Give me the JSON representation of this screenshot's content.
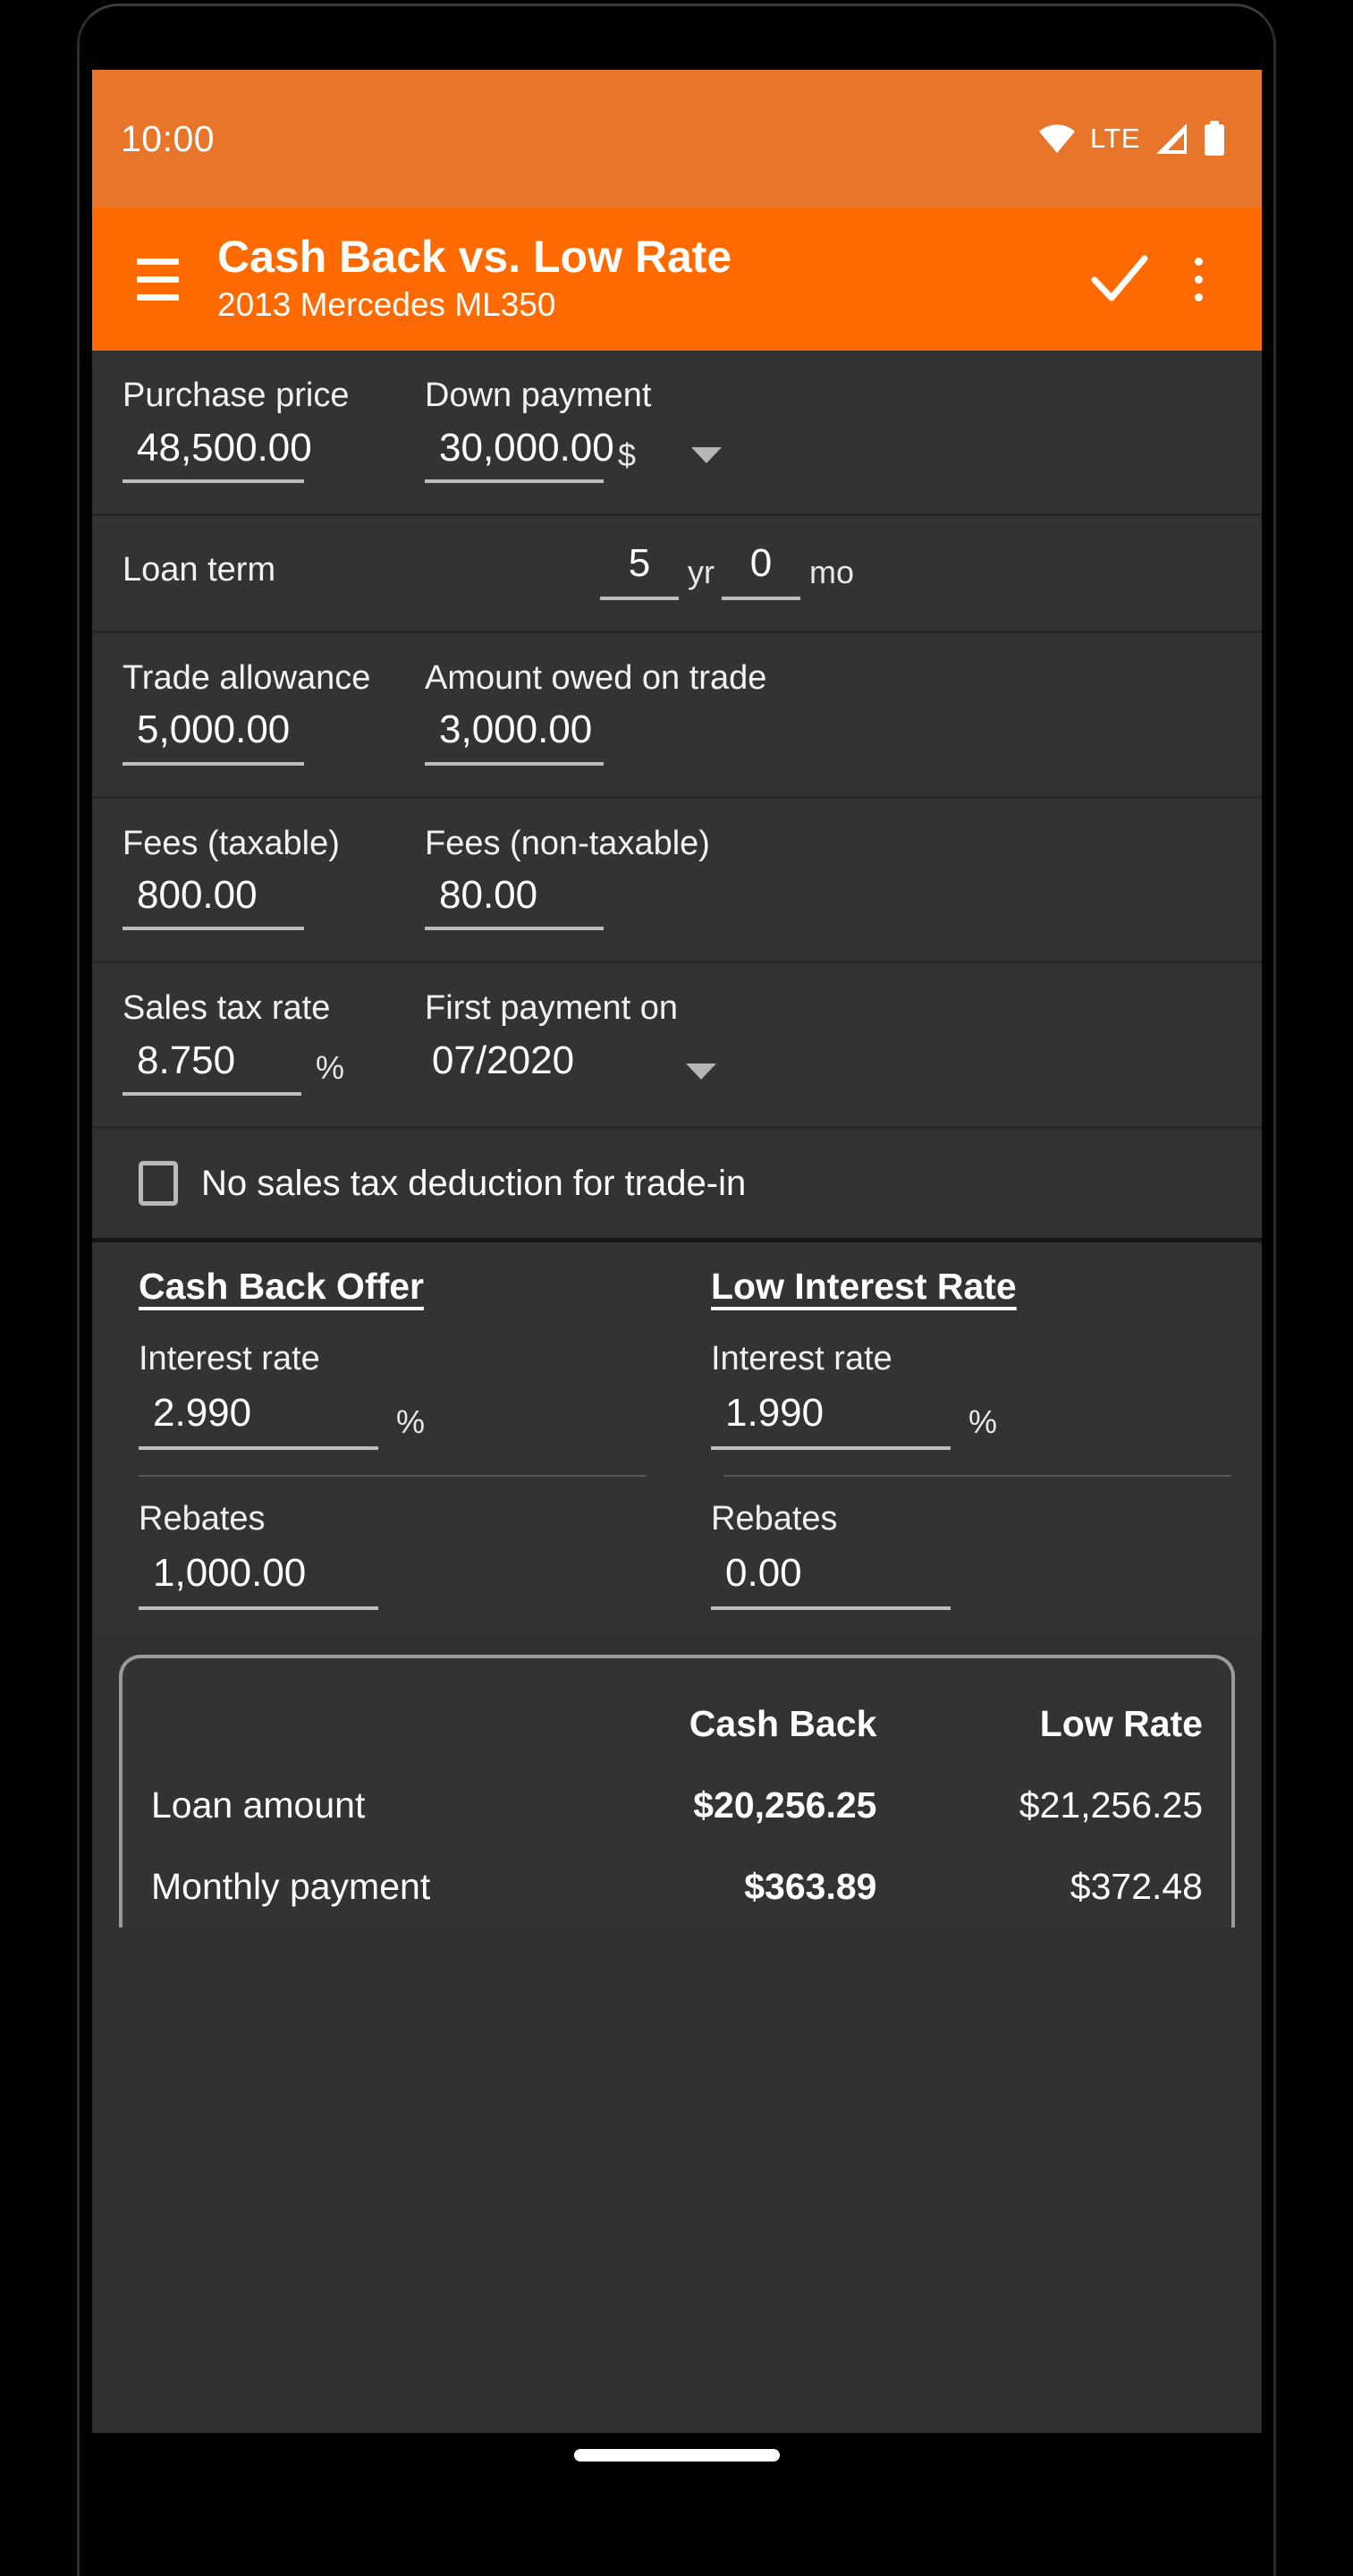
{
  "status_bar": {
    "clock": "10:00",
    "network_label": "LTE",
    "icons": [
      "wifi-icon",
      "signal-icon",
      "battery-icon"
    ]
  },
  "app_bar": {
    "menu_icon": "hamburger-menu-icon",
    "title": "Cash Back vs. Low Rate",
    "subtitle": "2013 Mercedes ML350",
    "confirm_icon": "checkmark-icon",
    "overflow_icon": "more-vertical-icon"
  },
  "colors": {
    "accent": "#ff6a00",
    "status_bar": "#e8762a",
    "surface": "#333333",
    "divider": "#272727",
    "underline": "#bdbdbd"
  },
  "form": {
    "purchase_price": {
      "label": "Purchase price",
      "value": "48,500.00"
    },
    "down_payment": {
      "label": "Down payment",
      "value": "30,000.00",
      "unit": "$",
      "dropdown_icon": "chevron-down-icon"
    },
    "loan_term": {
      "label": "Loan term",
      "years": "5",
      "years_suffix": "yr",
      "months": "0",
      "months_suffix": "mo"
    },
    "trade_allowance": {
      "label": "Trade allowance",
      "value": "5,000.00"
    },
    "amount_owed": {
      "label": "Amount owed on trade",
      "value": "3,000.00"
    },
    "fees_taxable": {
      "label": "Fees (taxable)",
      "value": "800.00"
    },
    "fees_nontaxable": {
      "label": "Fees (non-taxable)",
      "value": "80.00"
    },
    "sales_tax_rate": {
      "label": "Sales tax rate",
      "value": "8.750",
      "unit": "%"
    },
    "first_payment": {
      "label": "First payment on",
      "value": "07/2020",
      "dropdown_icon": "chevron-down-icon"
    },
    "no_tax_deduction": {
      "label": "No sales tax deduction for trade-in",
      "checked": false
    }
  },
  "compare": {
    "cash_back": {
      "heading": "Cash Back Offer",
      "interest_rate_label": "Interest rate",
      "interest_rate_value": "2.990",
      "interest_rate_unit": "%",
      "rebates_label": "Rebates",
      "rebates_value": "1,000.00"
    },
    "low_rate": {
      "heading": "Low Interest Rate",
      "interest_rate_label": "Interest rate",
      "interest_rate_value": "1.990",
      "interest_rate_unit": "%",
      "rebates_label": "Rebates",
      "rebates_value": "0.00"
    }
  },
  "results": {
    "col_blank": "",
    "col_cash_back": "Cash Back",
    "col_low_rate": "Low Rate",
    "rows": [
      {
        "label": "Loan amount",
        "cash_back": "$20,256.25",
        "low_rate": "$21,256.25"
      },
      {
        "label": "Monthly payment",
        "cash_back": "$363.89",
        "low_rate": "$372.48"
      }
    ]
  },
  "system_nav": {
    "gesture_pill": "home-gesture-pill"
  }
}
